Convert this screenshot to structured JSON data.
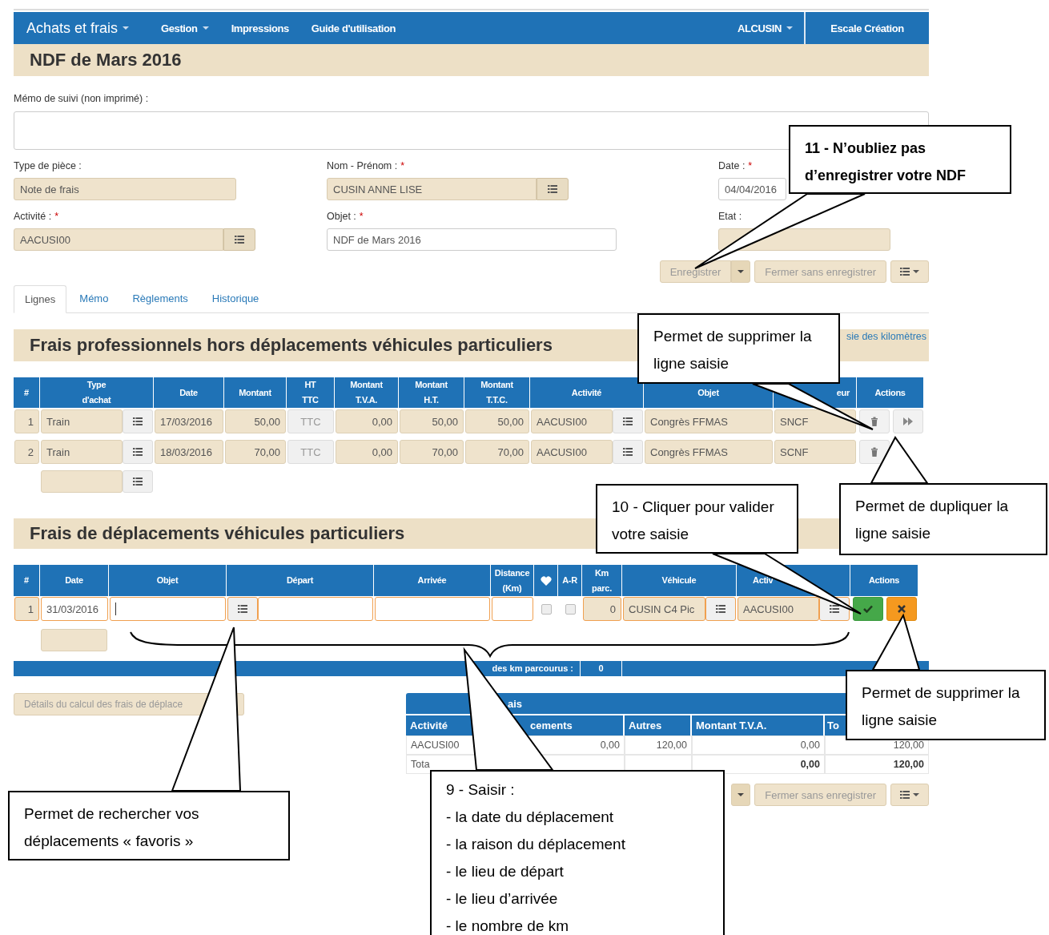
{
  "navbar": {
    "brand": {
      "label": "Achats et frais",
      "dropdown": true
    },
    "items": [
      {
        "label": "Gestion",
        "dropdown": true
      },
      {
        "label": "Impressions",
        "dropdown": false
      },
      {
        "label": "Guide d'utilisation",
        "dropdown": false
      }
    ],
    "right_items": [
      {
        "label": "ALCUSIN",
        "dropdown": true
      },
      {
        "label": "Escale Création",
        "dropdown": false
      }
    ]
  },
  "page_title": "NDF de Mars 2016",
  "memo": {
    "label": "Mémo de suivi (non imprimé) :"
  },
  "fields": [
    {
      "label": "Type de pièce :",
      "kind": "text",
      "value": "Note de frais",
      "editable": false
    },
    {
      "label": "Nom - Prénom :",
      "required_mark": "*",
      "kind": "lookup",
      "value": "CUSIN ANNE LISE",
      "editable": false
    },
    {
      "label": "Date :",
      "required_mark": "*",
      "kind": "text",
      "value": "04/04/2016",
      "editable": true
    },
    {
      "label": "Activité :",
      "required_mark": "*",
      "kind": "lookup",
      "value": "AACUSI00",
      "editable": false
    },
    {
      "label": "Objet :",
      "required_mark": "*",
      "kind": "text",
      "value": "NDF de Mars 2016",
      "editable": true
    },
    {
      "label": "Etat :",
      "kind": "text",
      "editable": false
    }
  ],
  "top_buttons": [
    {
      "kind": "split",
      "label": "Enregistrer"
    },
    {
      "kind": "plain",
      "label": "Fermer sans enregistrer"
    },
    {
      "kind": "menu"
    }
  ],
  "tabs": [
    {
      "label": "Lignes",
      "selected": true
    },
    {
      "label": "Mémo",
      "selected": false
    },
    {
      "label": "Règlements",
      "selected": false
    },
    {
      "label": "Historique",
      "selected": false
    }
  ],
  "section_1": {
    "title": "Frais professionnels hors déplacements véhicules particuliers",
    "link": "sie des kilomètres",
    "table": {
      "columns": [
        {
          "label": "#"
        },
        {
          "label": "Type\nd'achat"
        },
        {
          "label": "Date"
        },
        {
          "label": "Montant"
        },
        {
          "label": "HT\nTTC"
        },
        {
          "label": "Montant\nT.V.A."
        },
        {
          "label": "Montant\nH.T."
        },
        {
          "label": "Montant\nT.T.C."
        },
        {
          "label": "Activité"
        },
        {
          "label": "Objet"
        },
        {
          "label": "eur",
          "kind": "partial-end"
        },
        {
          "label": "Actions"
        }
      ],
      "rows": [
        {
          "editing": false,
          "cells": [
            {
              "kind": "number",
              "value": "1"
            },
            {
              "kind": "lookup",
              "value": "Train"
            },
            {
              "kind": "text",
              "value": "17/03/2016"
            },
            {
              "kind": "amount",
              "value": "50,00"
            },
            {
              "kind": "toggle",
              "value": "TTC"
            },
            {
              "kind": "amount",
              "value": "0,00"
            },
            {
              "kind": "amount",
              "value": "50,00"
            },
            {
              "kind": "amount",
              "value": "50,00"
            },
            {
              "kind": "lookup",
              "value": "AACUSI00"
            },
            {
              "kind": "text",
              "value": "Congrès FFMAS"
            },
            {
              "kind": "text",
              "value": "SNCF"
            }
          ],
          "actions": [
            {
              "kind": "delete"
            },
            {
              "kind": "duplicate"
            }
          ]
        },
        {
          "editing": false,
          "cells": [
            {
              "kind": "number",
              "value": "2"
            },
            {
              "kind": "lookup",
              "value": "Train"
            },
            {
              "kind": "text",
              "value": "18/03/2016"
            },
            {
              "kind": "amount",
              "value": "70,00"
            },
            {
              "kind": "toggle",
              "value": "TTC"
            },
            {
              "kind": "amount",
              "value": "0,00"
            },
            {
              "kind": "amount",
              "value": "70,00"
            },
            {
              "kind": "amount",
              "value": "70,00"
            },
            {
              "kind": "lookup",
              "value": "AACUSI00"
            },
            {
              "kind": "text",
              "value": "Congrès FFMAS"
            },
            {
              "kind": "text",
              "value": "SCNF"
            }
          ],
          "actions": [
            {
              "kind": "delete"
            }
          ]
        }
      ],
      "new_row": [
        {
          "kind": "lookup"
        }
      ]
    }
  },
  "section_2": {
    "title": "Frais de déplacements véhicules particuliers",
    "table": {
      "columns": [
        {
          "label": "#"
        },
        {
          "label": "Date"
        },
        {
          "label": "Objet"
        },
        {
          "label": "Départ"
        },
        {
          "label": "Arrivée"
        },
        {
          "label": "Distance\n(Km)"
        },
        {
          "kind": "heart"
        },
        {
          "label": "A-R"
        },
        {
          "label": "Km\nparc."
        },
        {
          "label": "Véhicule"
        },
        {
          "label": "Activ",
          "kind": "partial"
        },
        {
          "label": "Actions"
        }
      ],
      "rows": [
        {
          "editing": true,
          "cells": [
            {
              "kind": "number",
              "value": "1"
            },
            {
              "kind": "input",
              "value": "31/03/2016"
            },
            {
              "kind": "input",
              "focused": true
            },
            {
              "kind": "lookup-left"
            },
            {
              "kind": "input"
            },
            {
              "kind": "input"
            },
            {
              "kind": "check",
              "checked": false
            },
            {
              "kind": "check",
              "checked": false
            },
            {
              "kind": "amount",
              "value": "0"
            },
            {
              "kind": "lookup",
              "value": "CUSIN C4 Pic"
            },
            {
              "kind": "lookup",
              "value": "AACUSI00"
            }
          ],
          "actions": [
            {
              "kind": "validate"
            },
            {
              "kind": "cancel"
            }
          ]
        }
      ],
      "new_row": [
        {
          "kind": "text"
        }
      ]
    },
    "total_bar": {
      "label": "des km parcourus :",
      "value": "0"
    }
  },
  "details_button": "Détails du calcul des frais de déplace",
  "summary": {
    "title": "ais",
    "columns": [
      "Activité",
      "cements",
      "Autres",
      "Montant T.V.A.",
      "To"
    ],
    "rows": [
      {
        "total": false,
        "cells": [
          "AACUSI00",
          "0,00",
          "120,00",
          "0,00",
          "120,00"
        ]
      },
      {
        "total": true,
        "cells": [
          "Tota",
          null,
          null,
          "0,00",
          "120,00"
        ]
      }
    ]
  },
  "bottom_buttons": [
    {
      "kind": "caret"
    },
    {
      "kind": "plain",
      "label": "Fermer sans enregistrer"
    },
    {
      "kind": "menu"
    }
  ],
  "callouts": [
    {
      "kind": "note",
      "bold": true,
      "text": "11 - N’oubliez pas d’enregistrer votre NDF"
    },
    {
      "kind": "note",
      "bold": false,
      "text": "Permet de supprimer la ligne saisie"
    },
    {
      "kind": "note",
      "bold": false,
      "text": "10 - Cliquer pour valider votre saisie"
    },
    {
      "kind": "note",
      "bold": false,
      "text": "Permet de dupliquer la ligne saisie"
    },
    {
      "kind": "note",
      "bold": false,
      "text": "Permet de supprimer la ligne saisie"
    },
    {
      "kind": "note",
      "bold": false,
      "text": "Permet de rechercher vos déplacements « favoris »"
    },
    {
      "kind": "list",
      "bold": false,
      "heading": "9 - Saisir :",
      "lines": [
        "- la date du déplacement",
        "- la raison du déplacement",
        "- le lieu de départ",
        "- le lieu d’arrivée",
        "- le nombre de km"
      ]
    }
  ]
}
